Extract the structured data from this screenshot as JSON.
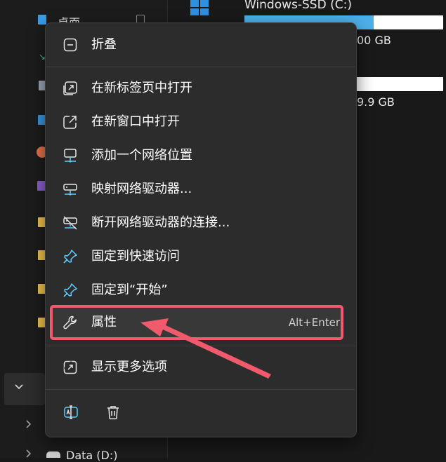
{
  "sidebar": {
    "items": [
      {
        "label": "桌面",
        "icon": "desktop-folder-icon"
      },
      {
        "label": "",
        "icon": "downloads-icon"
      },
      {
        "label": "",
        "icon": "documents-icon"
      },
      {
        "label": "",
        "icon": "pictures-icon"
      },
      {
        "label": "",
        "icon": "music-icon"
      },
      {
        "label": "",
        "icon": "videos-icon"
      },
      {
        "label": "",
        "icon": "folder-icon"
      },
      {
        "label": "",
        "icon": "folder-icon"
      },
      {
        "label": "",
        "icon": "folder-icon"
      },
      {
        "label": "",
        "icon": "folder-icon"
      }
    ],
    "bottom_item": "Data (D:)"
  },
  "drives": [
    {
      "name": "Windows-SSD (C:)",
      "size_text": "00 GB",
      "used_fraction": 0.65
    },
    {
      "name": "",
      "size_text": "9.9 GB",
      "used_fraction": 0.0
    }
  ],
  "menu": {
    "items": [
      {
        "label": "折叠",
        "icon": "collapse-icon",
        "shortcut": ""
      },
      {
        "label": "在新标签页中打开",
        "icon": "open-new-tab-icon",
        "shortcut": ""
      },
      {
        "label": "在新窗口中打开",
        "icon": "open-new-window-icon",
        "shortcut": ""
      },
      {
        "label": "添加一个网络位置",
        "icon": "add-network-location-icon",
        "shortcut": ""
      },
      {
        "label": "映射网络驱动器...",
        "icon": "map-network-drive-icon",
        "shortcut": ""
      },
      {
        "label": "断开网络驱动器的连接...",
        "icon": "disconnect-network-drive-icon",
        "shortcut": ""
      },
      {
        "label": "固定到快速访问",
        "icon": "pin-icon",
        "shortcut": ""
      },
      {
        "label": "固定到“开始”",
        "icon": "pin-start-icon",
        "shortcut": ""
      },
      {
        "label": "属性",
        "icon": "wrench-icon",
        "shortcut": "Alt+Enter"
      },
      {
        "label": "显示更多选项",
        "icon": "show-more-options-icon",
        "shortcut": ""
      }
    ],
    "bottom_actions": [
      {
        "name": "rename",
        "icon": "rename-icon"
      },
      {
        "name": "delete",
        "icon": "delete-icon"
      }
    ]
  },
  "annotation": {
    "highlight_color": "#f15a6d",
    "target": "属性"
  },
  "colors": {
    "menu_bg": "#2c2c2c",
    "icon_blue": "#60cdff",
    "drive_fill": "#4cb0e8"
  }
}
